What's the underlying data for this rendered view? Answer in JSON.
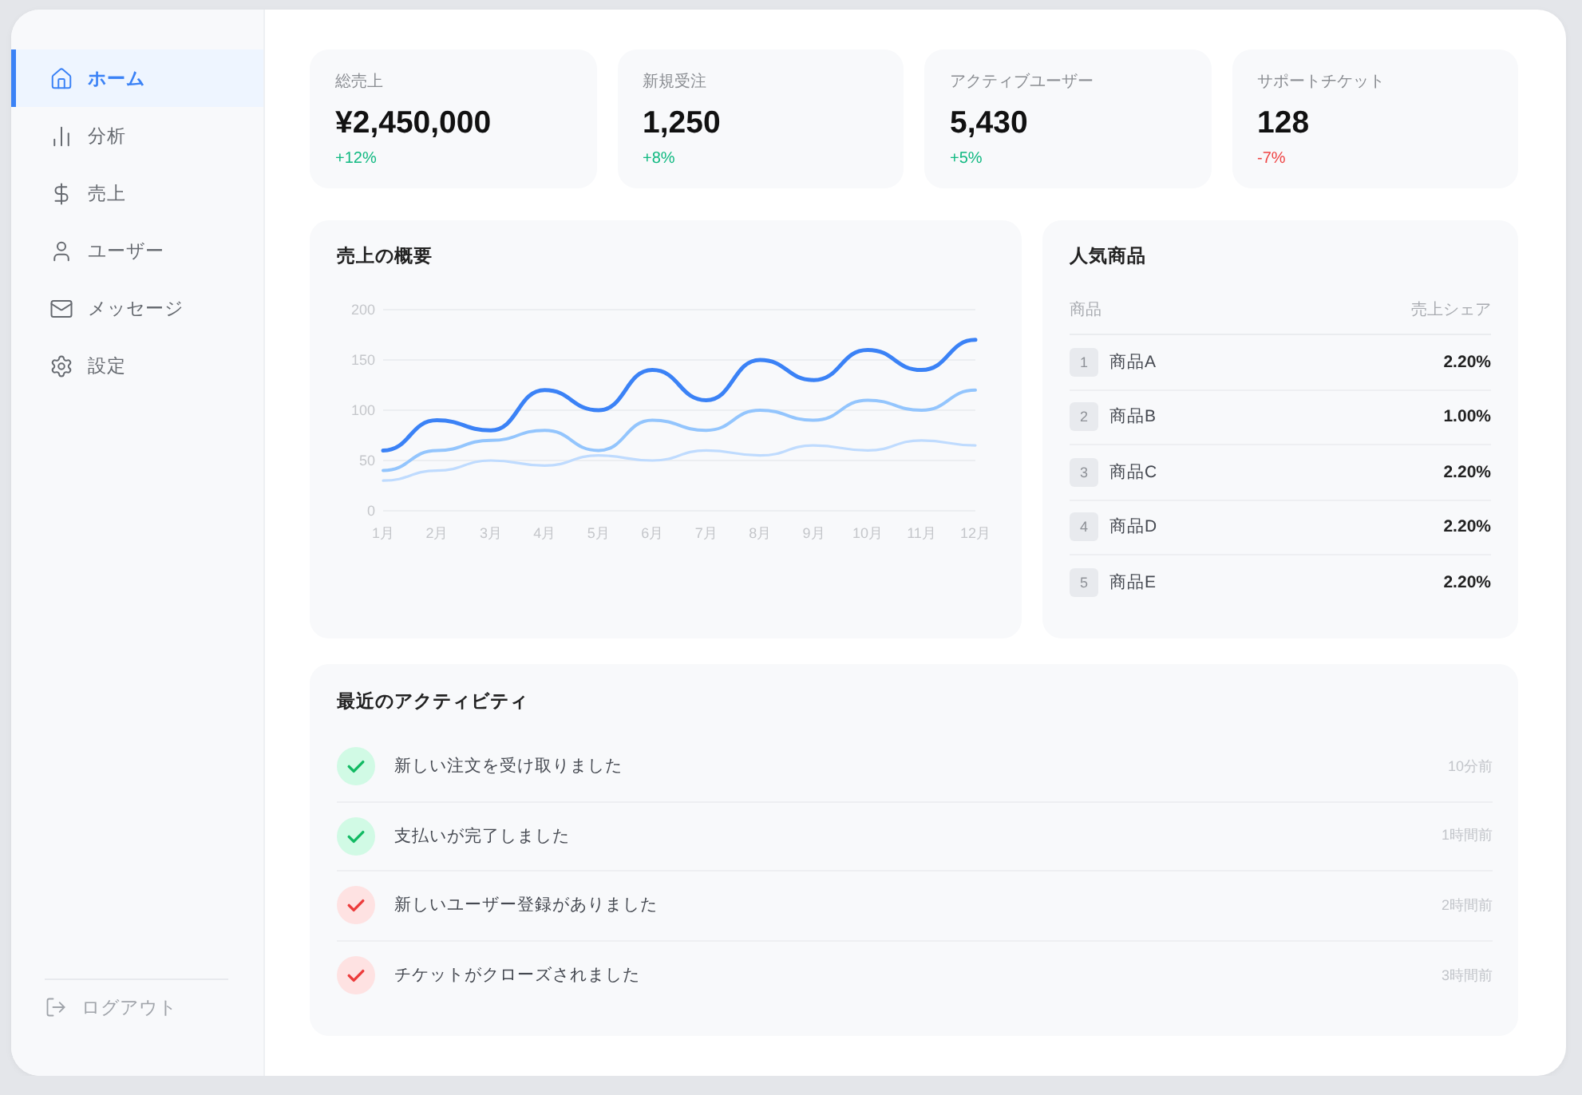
{
  "sidebar": {
    "items": [
      {
        "label": "ホーム",
        "selected": true
      },
      {
        "label": "分析",
        "selected": false
      },
      {
        "label": "売上",
        "selected": false
      },
      {
        "label": "ユーザー",
        "selected": false
      },
      {
        "label": "メッセージ",
        "selected": false
      },
      {
        "label": "設定",
        "selected": false
      }
    ],
    "logout": "ログアウト"
  },
  "stats": [
    {
      "label": "総売上",
      "value": "¥2,450,000",
      "change": "+12%",
      "color": "#10b981"
    },
    {
      "label": "新規受注",
      "value": "1,250",
      "change": "+8%",
      "color": "#10b981"
    },
    {
      "label": "アクティブユーザー",
      "value": "5,430",
      "change": "+5%",
      "color": "#10b981"
    },
    {
      "label": "サポートチケット",
      "value": "128",
      "change": "-7%",
      "color": "#ef4444"
    }
  ],
  "sales_chart": {
    "title": "売上の概要",
    "chart_data": {
      "type": "line",
      "grid": true,
      "categories": [
        "1月",
        "2月",
        "3月",
        "4月",
        "5月",
        "6月",
        "7月",
        "8月",
        "9月",
        "10月",
        "11月",
        "12月"
      ],
      "ylim": [
        0,
        200
      ],
      "yticks": [
        0,
        50,
        100,
        150,
        200
      ],
      "series": [
        {
          "color": "#3b82f6",
          "values": [
            60,
            90,
            80,
            120,
            100,
            140,
            110,
            150,
            130,
            160,
            140,
            170
          ]
        },
        {
          "color": "#93c5fd",
          "values": [
            40,
            60,
            70,
            80,
            60,
            90,
            80,
            100,
            90,
            110,
            100,
            120
          ]
        },
        {
          "color": "#bfdbfe",
          "values": [
            30,
            40,
            50,
            45,
            55,
            50,
            60,
            55,
            65,
            60,
            70,
            65
          ]
        }
      ]
    }
  },
  "popular_products": {
    "title": "人気商品",
    "columns": [
      "商品",
      "売上シェア"
    ],
    "rows": [
      {
        "rank": "1",
        "name": "商品A",
        "share": "2.20%"
      },
      {
        "rank": "2",
        "name": "商品B",
        "share": "1.00%"
      },
      {
        "rank": "3",
        "name": "商品C",
        "share": "2.20%"
      },
      {
        "rank": "4",
        "name": "商品D",
        "share": "2.20%"
      },
      {
        "rank": "5",
        "name": "商品E",
        "share": "2.20%"
      }
    ]
  },
  "recent_activity": {
    "title": "最近のアクティビティ",
    "items": [
      {
        "text": "新しい注文を受け取りました",
        "time": "10分前",
        "color": "#d1fae5"
      },
      {
        "text": "支払いが完了しました",
        "time": "1時間前",
        "color": "#d1fae5"
      },
      {
        "text": "新しいユーザー登録がありました",
        "time": "2時間前",
        "color": "#fee2e2"
      },
      {
        "text": "チケットがクローズされました",
        "time": "3時間前",
        "color": "#fee2e2"
      }
    ]
  }
}
